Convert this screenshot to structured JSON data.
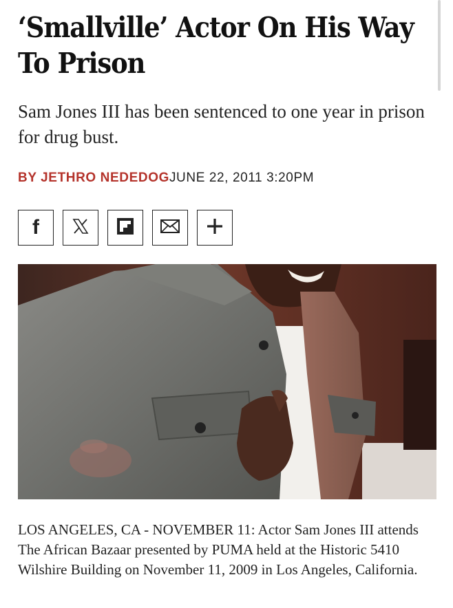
{
  "article": {
    "headline": "‘Smallville’ Actor On His Way To Prison",
    "dek": "Sam Jones III has been sentenced to one year in prison for drug bust.",
    "byline": {
      "prefix": "BY ",
      "author": "JETHRO NEDEDOG",
      "date": "JUNE 22, 2011 3:20PM"
    },
    "share": [
      {
        "name": "facebook",
        "icon": "facebook-icon",
        "glyph": "f"
      },
      {
        "name": "x",
        "icon": "x-icon",
        "glyph": "𝕏"
      },
      {
        "name": "flipboard",
        "icon": "flipboard-icon",
        "glyph": ""
      },
      {
        "name": "email",
        "icon": "email-icon",
        "glyph": ""
      },
      {
        "name": "more",
        "icon": "plus-icon",
        "glyph": "+"
      }
    ],
    "caption": "LOS ANGELES, CA - NOVEMBER 11:  Actor Sam Jones III attends The African Bazaar presented by PUMA held at the Historic 5410 Wilshire Building on November 11, 2009 in Los Angeles, California."
  },
  "colors": {
    "author": "#b4322a",
    "text": "#111111",
    "border": "#222222"
  }
}
